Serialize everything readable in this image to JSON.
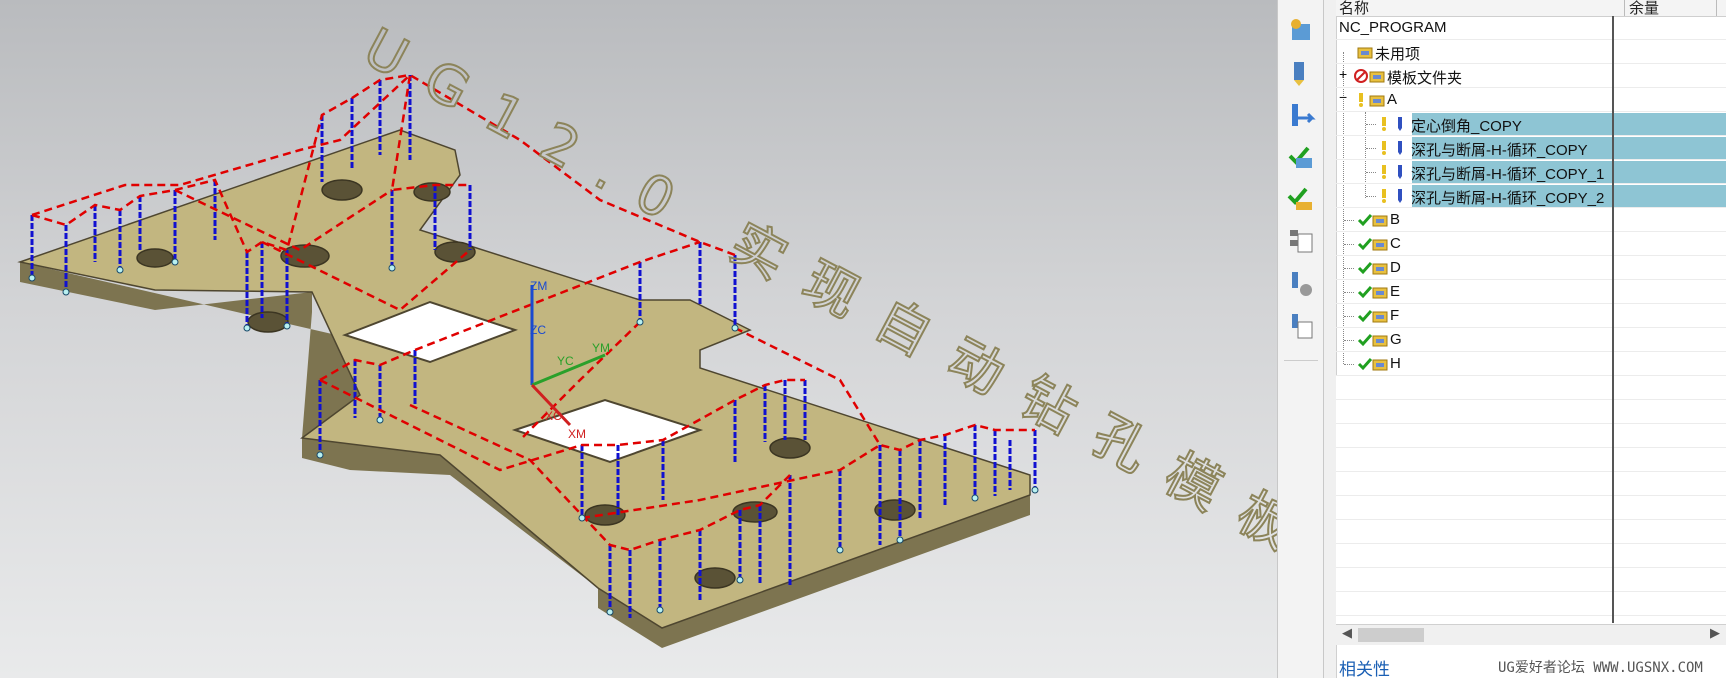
{
  "viewport": {
    "engraving": "UG12.0 实现自动钻孔模板",
    "axes": {
      "zm": "ZM",
      "zc": "ZC",
      "yc": "YC",
      "ym": "YM",
      "xc": "XC",
      "xm": "XM"
    }
  },
  "toolbar": {
    "icons": [
      "create-program-icon",
      "create-tool-icon",
      "create-geometry-icon",
      "create-method-icon",
      "generate-toolpath-icon",
      "verify-toolpath-icon",
      "postprocess-icon",
      "shop-doc-icon",
      "list-icon"
    ]
  },
  "navigator": {
    "columns": {
      "name": "名称",
      "stock": "余量"
    },
    "rows": [
      {
        "label": "NC_PROGRAM"
      },
      {
        "label": "未用项"
      },
      {
        "label": "模板文件夹"
      },
      {
        "label": "A"
      },
      {
        "label": "定心倒角_COPY"
      },
      {
        "label": "深孔与断屑-H-循环_COPY"
      },
      {
        "label": "深孔与断屑-H-循环_COPY_1"
      },
      {
        "label": "深孔与断屑-H-循环_COPY_2"
      },
      {
        "label": "B"
      },
      {
        "label": "C"
      },
      {
        "label": "D"
      },
      {
        "label": "E"
      },
      {
        "label": "F"
      },
      {
        "label": "G"
      },
      {
        "label": "H"
      }
    ],
    "expand_plus": "+",
    "expand_minus": "−"
  },
  "bottom": {
    "relevance_label": "相关性"
  },
  "watermark": "UG爱好者论坛 WWW.UGSNX.COM",
  "colors": {
    "plate": "#c2b680",
    "toolpath_rapid": "#e00000",
    "toolpath_feed": "#1010d0",
    "selection": "#8ec5d4"
  }
}
